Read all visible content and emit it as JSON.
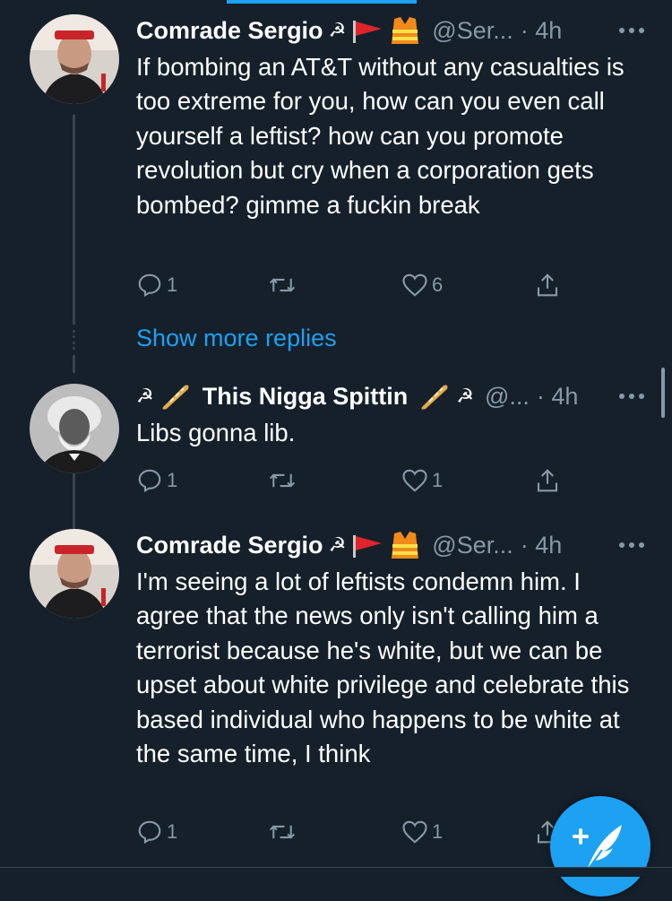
{
  "tweets": [
    {
      "name": "Comrade Sergio",
      "handle": "@Ser...",
      "time": "· 4h",
      "text": "If bombing an AT&T without any casualties is too extreme for you, how can you even call yourself a leftist? how can you promote revolution but cry when a corporation gets bombed? gimme a fuckin break",
      "replies": "1",
      "retweets": "",
      "likes": "6"
    },
    {
      "name": "This Nigga Spittin",
      "handle": "@...",
      "time": "· 4h",
      "text": "Libs gonna lib.",
      "replies": "1",
      "retweets": "",
      "likes": "1"
    },
    {
      "name": "Comrade Sergio",
      "handle": "@Ser...",
      "time": "· 4h",
      "text": "I'm seeing a lot of leftists condemn him. I agree that the news only isn't calling him a terrorist because he's white, but we can be upset about white privilege and celebrate this based individual who happens to be white at the same time, I think",
      "replies": "1",
      "retweets": "",
      "likes": "1"
    }
  ],
  "show_more_replies": "Show more replies",
  "icons": {
    "hammer_sickle": "☭",
    "more": "•••",
    "flag": "red-flag-icon",
    "vest": "safety-vest-icon",
    "bread": "baguette-icon",
    "reply": "reply-icon",
    "retweet": "retweet-icon",
    "like": "heart-icon",
    "share": "share-icon",
    "compose": "compose-tweet-icon"
  },
  "colors": {
    "background": "#15202b",
    "accent": "#1da1f2",
    "secondary_text": "#8899a6",
    "thread_line": "#38444d"
  }
}
